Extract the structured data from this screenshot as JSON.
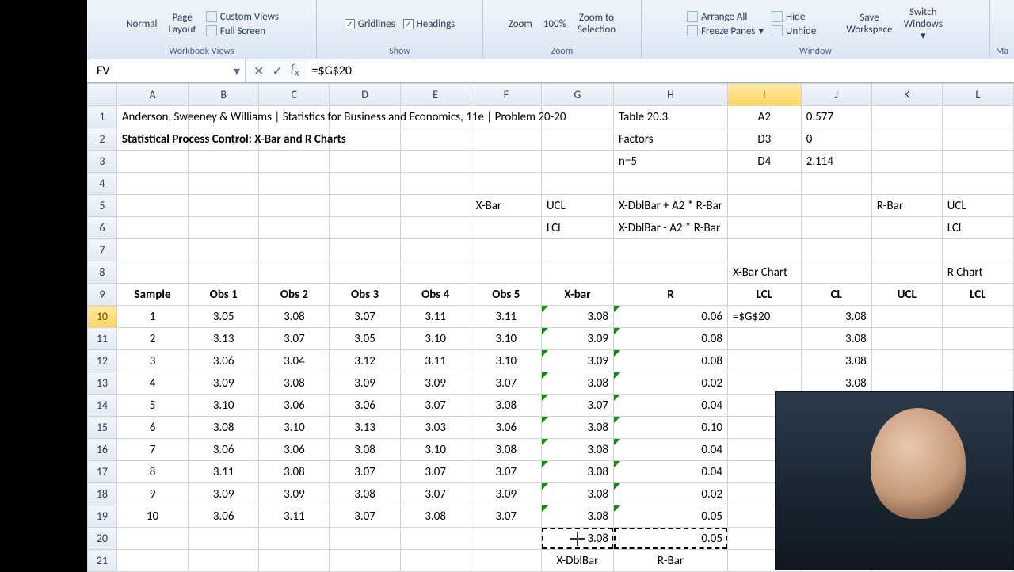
{
  "ribbon": {
    "views": {
      "normal": "Normal",
      "page_layout": "Page\nLayout",
      "custom_views": "Custom Views",
      "full_screen": "Full Screen",
      "group": "Workbook Views"
    },
    "show": {
      "gridlines": "Gridlines",
      "headings": "Headings",
      "group": "Show"
    },
    "zoom": {
      "zoom": "Zoom",
      "pct": "100%",
      "to_sel": "Zoom to\nSelection",
      "group": "Zoom"
    },
    "window": {
      "arrange": "Arrange All",
      "freeze": "Freeze Panes",
      "hide": "Hide",
      "unhide": "Unhide",
      "save_ws": "Save\nWorkspace",
      "switch": "Switch\nWindows",
      "group": "Window"
    },
    "macros": "Ma"
  },
  "formulaBar": {
    "nameBox": "FV",
    "formula": "=$G$20"
  },
  "columns": [
    "A",
    "B",
    "C",
    "D",
    "E",
    "F",
    "G",
    "H",
    "I",
    "J",
    "K",
    "L"
  ],
  "rows": [
    {
      "n": 1,
      "cells": {
        "A": "Anderson, Sweeney & Williams | Statistics for Business and Economics, 11e | Problem 20-20",
        "H": "Table 20.3",
        "I": "A2",
        "J": "0.577"
      }
    },
    {
      "n": 2,
      "cells": {
        "A": "Statistical Process Control:  X-Bar and R Charts",
        "H": "Factors",
        "I": "D3",
        "J": "0"
      }
    },
    {
      "n": 3,
      "cells": {
        "H": "n=5",
        "I": "D4",
        "J": "2.114"
      }
    },
    {
      "n": 4,
      "cells": {}
    },
    {
      "n": 5,
      "cells": {
        "F": "X-Bar",
        "G": "UCL",
        "H": "X-DblBar + A2 * R-Bar",
        "K": "R-Bar",
        "L": "UCL"
      }
    },
    {
      "n": 6,
      "cells": {
        "G": "LCL",
        "H": "X-DblBar - A2 * R-Bar",
        "L": "LCL"
      }
    },
    {
      "n": 7,
      "cells": {}
    },
    {
      "n": 8,
      "cells": {
        "I": "X-Bar Chart",
        "L": "R Chart"
      }
    },
    {
      "n": 9,
      "cells": {
        "A": "Sample",
        "B": "Obs 1",
        "C": "Obs 2",
        "D": "Obs 3",
        "E": "Obs 4",
        "F": "Obs 5",
        "G": "X-bar",
        "H": "R",
        "I": "LCL",
        "J": "CL",
        "K": "UCL",
        "L": "LCL"
      }
    },
    {
      "n": 10,
      "cells": {
        "A": "1",
        "B": "3.05",
        "C": "3.08",
        "D": "3.07",
        "E": "3.11",
        "F": "3.11",
        "G": "3.08",
        "H": "0.06",
        "I": "=$G$20",
        "J": "3.08"
      }
    },
    {
      "n": 11,
      "cells": {
        "A": "2",
        "B": "3.13",
        "C": "3.07",
        "D": "3.05",
        "E": "3.10",
        "F": "3.10",
        "G": "3.09",
        "H": "0.08",
        "J": "3.08"
      }
    },
    {
      "n": 12,
      "cells": {
        "A": "3",
        "B": "3.06",
        "C": "3.04",
        "D": "3.12",
        "E": "3.11",
        "F": "3.10",
        "G": "3.09",
        "H": "0.08",
        "J": "3.08"
      }
    },
    {
      "n": 13,
      "cells": {
        "A": "4",
        "B": "3.09",
        "C": "3.08",
        "D": "3.09",
        "E": "3.09",
        "F": "3.07",
        "G": "3.08",
        "H": "0.02",
        "J": "3.08"
      }
    },
    {
      "n": 14,
      "cells": {
        "A": "5",
        "B": "3.10",
        "C": "3.06",
        "D": "3.06",
        "E": "3.07",
        "F": "3.08",
        "G": "3.07",
        "H": "0.04"
      }
    },
    {
      "n": 15,
      "cells": {
        "A": "6",
        "B": "3.08",
        "C": "3.10",
        "D": "3.13",
        "E": "3.03",
        "F": "3.06",
        "G": "3.08",
        "H": "0.10"
      }
    },
    {
      "n": 16,
      "cells": {
        "A": "7",
        "B": "3.06",
        "C": "3.06",
        "D": "3.08",
        "E": "3.10",
        "F": "3.08",
        "G": "3.08",
        "H": "0.04"
      }
    },
    {
      "n": 17,
      "cells": {
        "A": "8",
        "B": "3.11",
        "C": "3.08",
        "D": "3.07",
        "E": "3.07",
        "F": "3.07",
        "G": "3.08",
        "H": "0.04"
      }
    },
    {
      "n": 18,
      "cells": {
        "A": "9",
        "B": "3.09",
        "C": "3.09",
        "D": "3.08",
        "E": "3.07",
        "F": "3.09",
        "G": "3.08",
        "H": "0.02"
      }
    },
    {
      "n": 19,
      "cells": {
        "A": "10",
        "B": "3.06",
        "C": "3.11",
        "D": "3.07",
        "E": "3.08",
        "F": "3.07",
        "G": "3.08",
        "H": "0.05"
      }
    },
    {
      "n": 20,
      "cells": {
        "G": "3.08",
        "H": "0.05"
      }
    },
    {
      "n": 21,
      "cells": {
        "G": "X-DblBar",
        "H": "R-Bar"
      }
    }
  ],
  "meta": {
    "activeCell": "I10",
    "selectedCol": "I",
    "selectedRow": 10,
    "antsRange": [
      "G20",
      "H20"
    ],
    "gerrCols": [
      "G",
      "H"
    ],
    "gerrRowsStart": 10,
    "gerrRowsEnd": 19
  }
}
